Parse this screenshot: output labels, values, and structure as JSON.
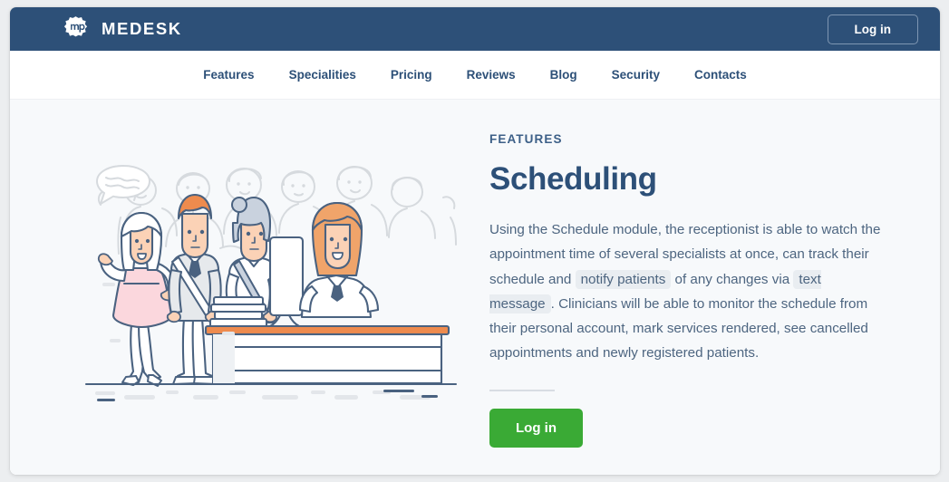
{
  "brand": {
    "logo_icon": "medesk-badge-icon",
    "name": "MEDESK"
  },
  "topbar": {
    "login_label": "Log in"
  },
  "nav": {
    "items": [
      {
        "label": "Features"
      },
      {
        "label": "Specialities"
      },
      {
        "label": "Pricing"
      },
      {
        "label": "Reviews"
      },
      {
        "label": "Blog"
      },
      {
        "label": "Security"
      },
      {
        "label": "Contacts"
      }
    ]
  },
  "hero": {
    "eyebrow": "FEATURES",
    "headline": "Scheduling",
    "paragraph": {
      "part1": "Using the Schedule module, the receptionist is able to watch the appointment time of several specialists at once, can track their schedule and ",
      "chip1": "notify patients",
      "part2": " of any changes via ",
      "chip2": "text message",
      "part3": ". Clinicians will be able to monitor the schedule from their personal account, mark services rendered, see cancelled appointments and newly registered patients."
    },
    "cta_label": "Log in",
    "illustration_name": "clinic-reception-queue-illustration"
  },
  "colors": {
    "header_navy": "#2d5078",
    "cta_green": "#3aaa35",
    "page_background": "#f7f9fb",
    "chip_background": "#e9edf1",
    "body_text": "#4d6580"
  }
}
